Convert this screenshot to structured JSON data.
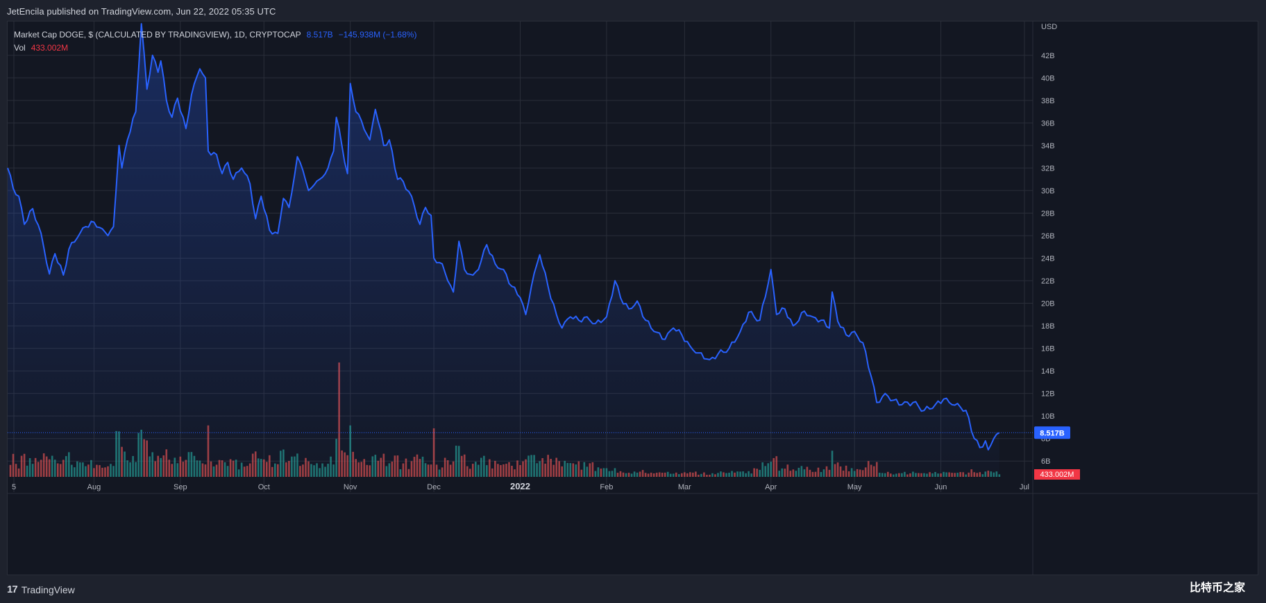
{
  "header": {
    "published": "JetEncila published on TradingView.com, Jun 22, 2022 05:35 UTC"
  },
  "legend": {
    "symbol": "Market Cap DOGE, $ (CALCULATED BY TRADINGVIEW), 1D, CRYPTOCAP",
    "last_value": "8.517B",
    "change": "−145.938M (−1.68%)",
    "vol_label": "Vol",
    "vol_value": "433.002M"
  },
  "footer": {
    "brand": "TradingView",
    "watermark": "比特币之家"
  },
  "colors": {
    "line": "#2962ff",
    "vol_up": "#26a69a",
    "vol_down": "#ef5350",
    "grid": "#2a2e39",
    "bg": "#131722"
  },
  "chart_data": {
    "type": "area",
    "title": "Market Cap DOGE, $ (CALCULATED BY TRADINGVIEW), 1D, CRYPTOCAP",
    "y_unit": "USD",
    "y_axis": {
      "unit": "USD",
      "ticks": [
        "42B",
        "40B",
        "38B",
        "36B",
        "34B",
        "32B",
        "30B",
        "28B",
        "26B",
        "24B",
        "22B",
        "20B",
        "18B",
        "16B",
        "14B",
        "12B",
        "10B",
        "8B",
        "6B"
      ],
      "tick_values": [
        42,
        40,
        38,
        36,
        34,
        32,
        30,
        28,
        26,
        24,
        22,
        20,
        18,
        16,
        14,
        12,
        10,
        8,
        6
      ],
      "range_billions": [
        4.6,
        45
      ]
    },
    "x_axis": {
      "ticks": [
        "5",
        "Aug",
        "Sep",
        "Oct",
        "Nov",
        "Dec",
        "2022",
        "Feb",
        "Mar",
        "Apr",
        "May",
        "Jun",
        "Jul"
      ],
      "tick_dates": [
        "2021-07-05",
        "2021-08-01",
        "2021-09-01",
        "2021-10-01",
        "2021-11-01",
        "2021-12-01",
        "2022-01-01",
        "2022-02-01",
        "2022-03-01",
        "2022-04-01",
        "2022-05-01",
        "2022-06-01",
        "2022-07-01"
      ],
      "bold_ticks": [
        "2022"
      ]
    },
    "last_value_label": "8.517B",
    "last_value": 8.517,
    "volume_last_label": "433.002M",
    "market_cap_anchors": [
      [
        "2021-07-01",
        32.0
      ],
      [
        "2021-07-03",
        30.2
      ],
      [
        "2021-07-05",
        29.5
      ],
      [
        "2021-07-07",
        27.0
      ],
      [
        "2021-07-10",
        28.4
      ],
      [
        "2021-07-13",
        26.2
      ],
      [
        "2021-07-16",
        22.6
      ],
      [
        "2021-07-18",
        24.4
      ],
      [
        "2021-07-21",
        22.5
      ],
      [
        "2021-07-23",
        24.8
      ],
      [
        "2021-07-26",
        25.8
      ],
      [
        "2021-07-29",
        26.8
      ],
      [
        "2021-08-01",
        27.2
      ],
      [
        "2021-08-04",
        26.6
      ],
      [
        "2021-08-06",
        26.0
      ],
      [
        "2021-08-08",
        26.8
      ],
      [
        "2021-08-10",
        34.0
      ],
      [
        "2021-08-11",
        32.0
      ],
      [
        "2021-08-13",
        34.5
      ],
      [
        "2021-08-16",
        37.0
      ],
      [
        "2021-08-18",
        44.8
      ],
      [
        "2021-08-20",
        39.0
      ],
      [
        "2021-08-22",
        42.0
      ],
      [
        "2021-08-24",
        40.5
      ],
      [
        "2021-08-25",
        41.5
      ],
      [
        "2021-08-27",
        38.0
      ],
      [
        "2021-08-29",
        36.5
      ],
      [
        "2021-08-31",
        38.2
      ],
      [
        "2021-09-03",
        35.5
      ],
      [
        "2021-09-05",
        38.5
      ],
      [
        "2021-09-08",
        40.8
      ],
      [
        "2021-09-10",
        40.0
      ],
      [
        "2021-09-11",
        33.5
      ],
      [
        "2021-09-14",
        33.2
      ],
      [
        "2021-09-16",
        31.5
      ],
      [
        "2021-09-18",
        32.5
      ],
      [
        "2021-09-20",
        31.0
      ],
      [
        "2021-09-23",
        32.0
      ],
      [
        "2021-09-26",
        30.6
      ],
      [
        "2021-09-28",
        27.5
      ],
      [
        "2021-09-30",
        29.5
      ],
      [
        "2021-10-03",
        26.5
      ],
      [
        "2021-10-06",
        26.2
      ],
      [
        "2021-10-08",
        29.3
      ],
      [
        "2021-10-10",
        28.5
      ],
      [
        "2021-10-13",
        33.0
      ],
      [
        "2021-10-15",
        31.8
      ],
      [
        "2021-10-17",
        30.0
      ],
      [
        "2021-10-19",
        30.5
      ],
      [
        "2021-10-21",
        31.0
      ],
      [
        "2021-10-24",
        32.0
      ],
      [
        "2021-10-26",
        33.5
      ],
      [
        "2021-10-27",
        36.5
      ],
      [
        "2021-10-29",
        34.0
      ],
      [
        "2021-10-31",
        31.5
      ],
      [
        "2021-11-01",
        39.5
      ],
      [
        "2021-11-03",
        37.0
      ],
      [
        "2021-11-05",
        36.2
      ],
      [
        "2021-11-08",
        34.5
      ],
      [
        "2021-11-10",
        37.2
      ],
      [
        "2021-11-13",
        34.0
      ],
      [
        "2021-11-15",
        34.5
      ],
      [
        "2021-11-18",
        31.0
      ],
      [
        "2021-11-20",
        30.8
      ],
      [
        "2021-11-23",
        29.5
      ],
      [
        "2021-11-26",
        27.0
      ],
      [
        "2021-11-28",
        28.5
      ],
      [
        "2021-11-30",
        27.8
      ],
      [
        "2021-12-01",
        24.0
      ],
      [
        "2021-12-04",
        23.5
      ],
      [
        "2021-12-06",
        22.0
      ],
      [
        "2021-12-08",
        21.0
      ],
      [
        "2021-12-10",
        25.5
      ],
      [
        "2021-12-12",
        23.0
      ],
      [
        "2021-12-15",
        22.5
      ],
      [
        "2021-12-17",
        23.0
      ],
      [
        "2021-12-20",
        25.2
      ],
      [
        "2021-12-23",
        23.5
      ],
      [
        "2021-12-26",
        23.0
      ],
      [
        "2021-12-29",
        21.5
      ],
      [
        "2022-01-01",
        20.5
      ],
      [
        "2022-01-03",
        19.0
      ],
      [
        "2022-01-05",
        21.5
      ],
      [
        "2022-01-08",
        24.3
      ],
      [
        "2022-01-11",
        21.5
      ],
      [
        "2022-01-14",
        19.0
      ],
      [
        "2022-01-16",
        17.8
      ],
      [
        "2022-01-19",
        18.8
      ],
      [
        "2022-01-22",
        18.5
      ],
      [
        "2022-01-25",
        18.8
      ],
      [
        "2022-01-28",
        18.2
      ],
      [
        "2022-02-01",
        18.8
      ],
      [
        "2022-02-04",
        22.0
      ],
      [
        "2022-02-06",
        20.5
      ],
      [
        "2022-02-09",
        19.5
      ],
      [
        "2022-02-12",
        20.2
      ],
      [
        "2022-02-15",
        18.5
      ],
      [
        "2022-02-18",
        17.5
      ],
      [
        "2022-02-22",
        16.8
      ],
      [
        "2022-02-25",
        17.8
      ],
      [
        "2022-02-28",
        17.2
      ],
      [
        "2022-03-03",
        16.2
      ],
      [
        "2022-03-06",
        15.6
      ],
      [
        "2022-03-10",
        15.0
      ],
      [
        "2022-03-13",
        15.5
      ],
      [
        "2022-03-17",
        16.0
      ],
      [
        "2022-03-21",
        17.5
      ],
      [
        "2022-03-24",
        19.2
      ],
      [
        "2022-03-28",
        18.5
      ],
      [
        "2022-04-01",
        23.0
      ],
      [
        "2022-04-03",
        19.0
      ],
      [
        "2022-04-06",
        19.5
      ],
      [
        "2022-04-09",
        18.0
      ],
      [
        "2022-04-13",
        19.3
      ],
      [
        "2022-04-16",
        18.8
      ],
      [
        "2022-04-19",
        18.5
      ],
      [
        "2022-04-22",
        17.8
      ],
      [
        "2022-04-23",
        21.0
      ],
      [
        "2022-04-25",
        18.4
      ],
      [
        "2022-04-28",
        17.2
      ],
      [
        "2022-05-01",
        17.5
      ],
      [
        "2022-05-04",
        16.5
      ],
      [
        "2022-05-07",
        13.5
      ],
      [
        "2022-05-09",
        11.2
      ],
      [
        "2022-05-12",
        12.0
      ],
      [
        "2022-05-15",
        11.4
      ],
      [
        "2022-05-18",
        11.0
      ],
      [
        "2022-05-22",
        11.2
      ],
      [
        "2022-05-26",
        10.5
      ],
      [
        "2022-05-30",
        11.0
      ],
      [
        "2022-06-02",
        11.5
      ],
      [
        "2022-06-05",
        11.0
      ],
      [
        "2022-06-08",
        10.8
      ],
      [
        "2022-06-10",
        10.5
      ],
      [
        "2022-06-13",
        8.0
      ],
      [
        "2022-06-15",
        7.2
      ],
      [
        "2022-06-17",
        7.8
      ],
      [
        "2022-06-18",
        7.0
      ],
      [
        "2022-06-20",
        8.0
      ],
      [
        "2022-06-22",
        8.517
      ]
    ],
    "volume_spike_labels": []
  }
}
